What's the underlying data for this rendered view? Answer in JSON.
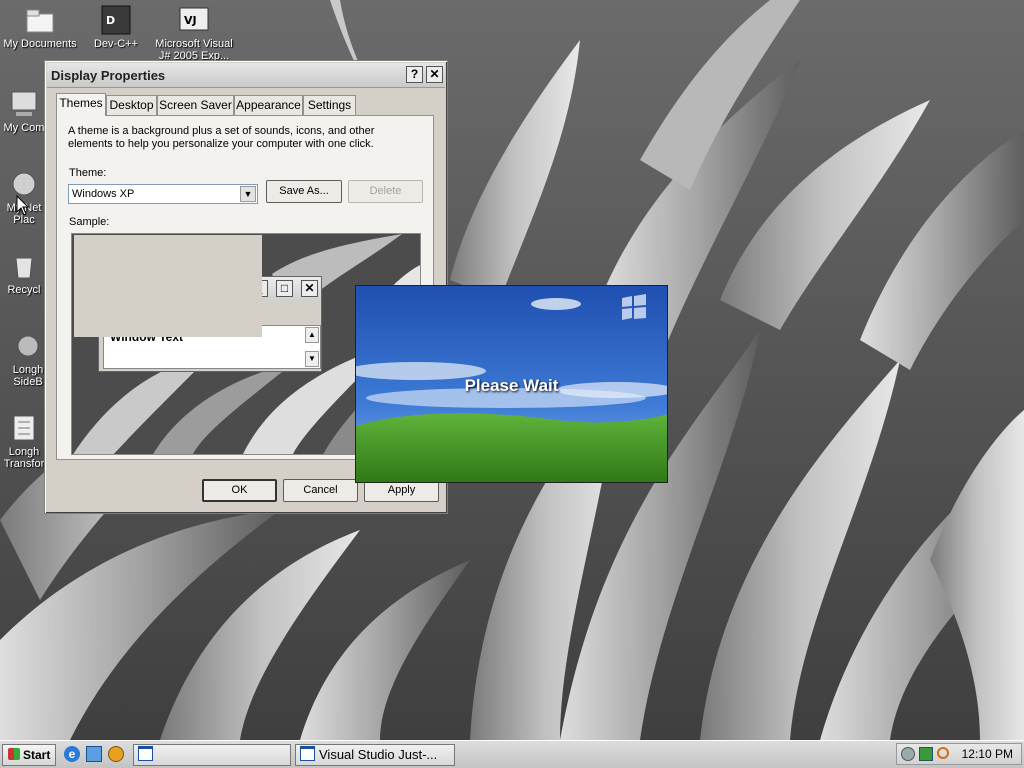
{
  "desktop": {
    "icons": [
      {
        "label": "My Documents",
        "icon": "folder-documents-icon"
      },
      {
        "label": "Dev-C++",
        "icon": "devcpp-icon"
      },
      {
        "label": "Microsoft Visual",
        "label2": "J# 2005 Exp...",
        "icon": "visual-j-icon"
      },
      {
        "label": "My Com",
        "icon": "my-computer-icon"
      },
      {
        "label": "My Net",
        "label2": "Plac",
        "icon": "network-places-icon"
      },
      {
        "label": "Recycl",
        "icon": "recycle-bin-icon"
      },
      {
        "label": "Longh",
        "label2": "SideB",
        "icon": "longhorn-sidebar-icon"
      },
      {
        "label": "Longh",
        "label2": "Transfor",
        "icon": "longhorn-transformation-icon"
      }
    ]
  },
  "display_properties": {
    "title": "Display Properties",
    "help_button": "?",
    "close_button": "✕",
    "tabs": [
      {
        "label": "Themes",
        "active": true
      },
      {
        "label": "Desktop",
        "active": false
      },
      {
        "label": "Screen Saver",
        "active": false
      },
      {
        "label": "Appearance",
        "active": false
      },
      {
        "label": "Settings",
        "active": false
      }
    ],
    "description": "A theme is a background plus a set of sounds, icons, and other elements to help you personalize your computer with one click.",
    "theme_label": "Theme:",
    "theme_value": "Windows XP",
    "save_as_label": "Save As...",
    "delete_label": "Delete",
    "sample_label": "Sample:",
    "sample_window_text": "Window Text",
    "ok_label": "OK",
    "cancel_label": "Cancel",
    "apply_label": "Apply"
  },
  "splash": {
    "message": "Please Wait"
  },
  "taskbar": {
    "start_label": "Start",
    "quicklaunch": [
      "internet-explorer-icon",
      "outlook-express-icon",
      "media-player-icon"
    ],
    "tasks": [
      {
        "label": "",
        "icon": "window-icon"
      },
      {
        "label": "Visual Studio Just-...",
        "icon": "window-icon"
      }
    ],
    "clock": "12:10 PM"
  },
  "colors": {
    "window_face": "#d4d0c8",
    "splash_sky": "#2a5fbf",
    "splash_grass": "#3c8f1e"
  }
}
